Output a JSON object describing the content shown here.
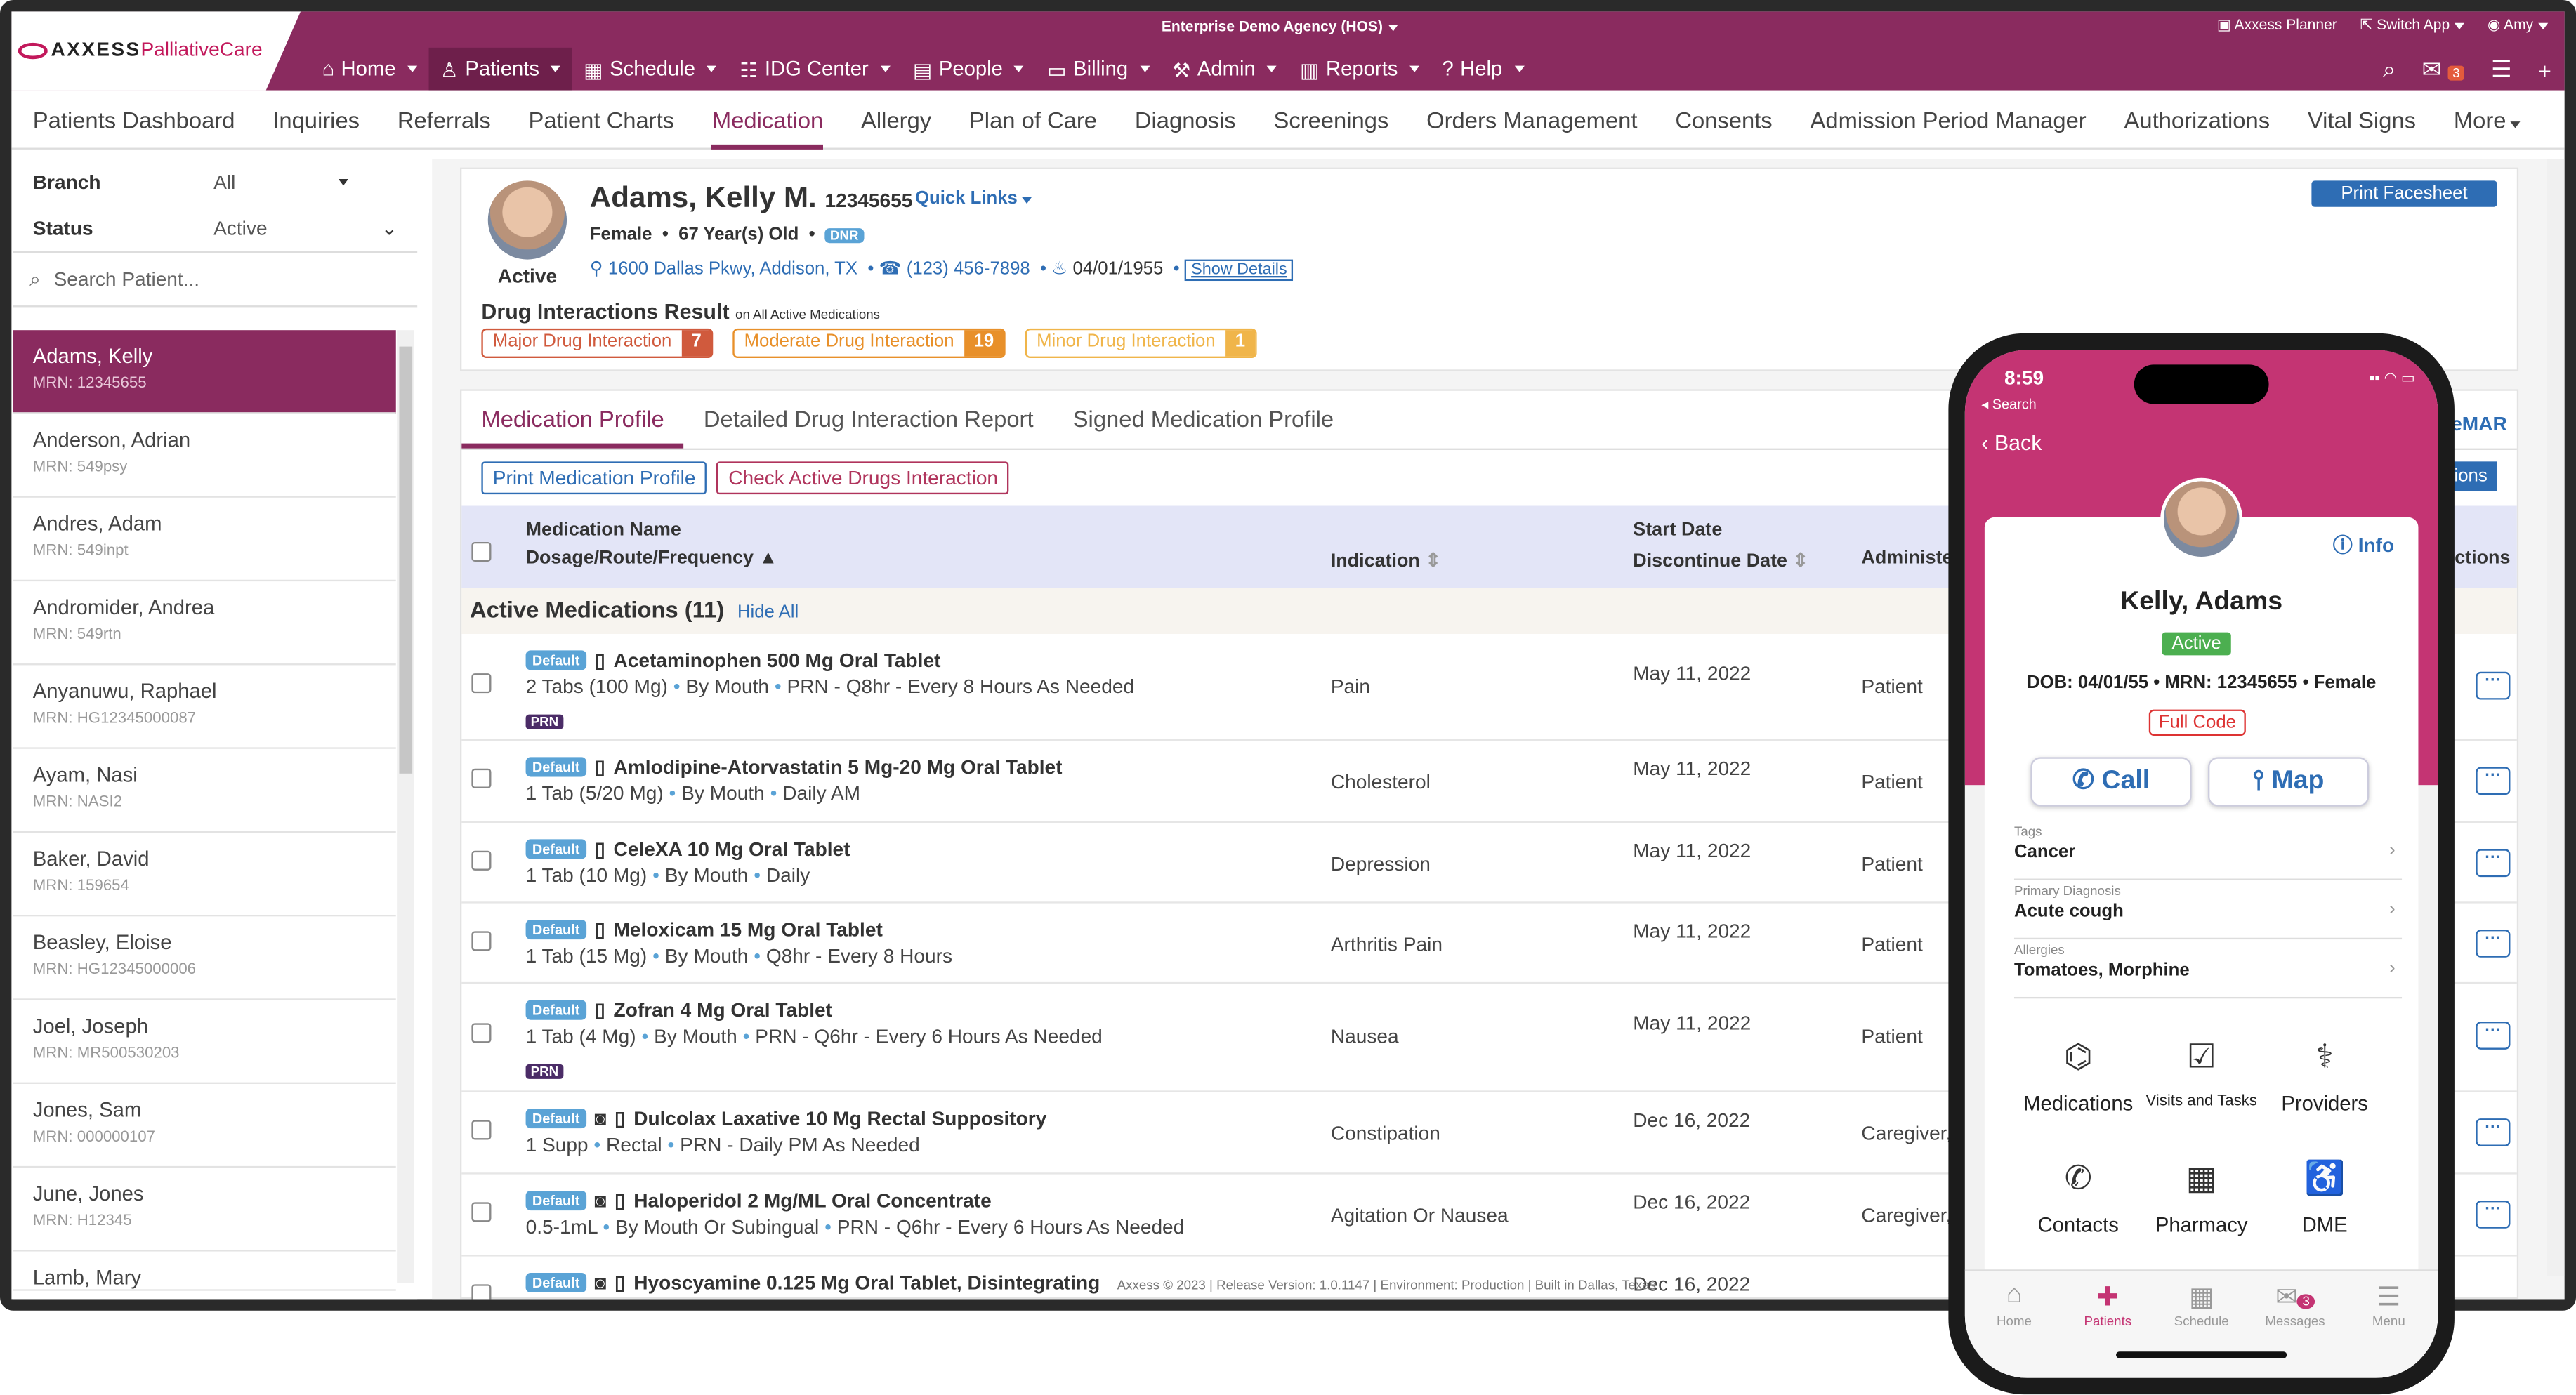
{
  "topbar": {
    "agency": "Enterprise Demo Agency (HOS)",
    "planner": "Axxess Planner",
    "switch_app": "Switch App",
    "user": "Amy",
    "mail_badge": "3"
  },
  "logo": {
    "brand": "AXXESS",
    "product": "PalliativeCare"
  },
  "mainnav": [
    "Home",
    "Patients",
    "Schedule",
    "IDG Center",
    "People",
    "Billing",
    "Admin",
    "Reports",
    "Help"
  ],
  "subnav": [
    "Patients Dashboard",
    "Inquiries",
    "Referrals",
    "Patient Charts",
    "Medication",
    "Allergy",
    "Plan of Care",
    "Diagnosis",
    "Screenings",
    "Orders Management",
    "Consents",
    "Admission Period Manager",
    "Authorizations",
    "Vital Signs",
    "More"
  ],
  "sidebar": {
    "branch_label": "Branch",
    "branch_value": "All",
    "status_label": "Status",
    "status_value": "Active",
    "search_placeholder": "Search Patient...",
    "patients": [
      {
        "name": "Adams, Kelly",
        "mrn": "MRN: 12345655"
      },
      {
        "name": "Anderson, Adrian",
        "mrn": "MRN: 549psy"
      },
      {
        "name": "Andres, Adam",
        "mrn": "MRN: 549inpt"
      },
      {
        "name": "Andromider, Andrea",
        "mrn": "MRN: 549rtn"
      },
      {
        "name": "Anyanuwu, Raphael",
        "mrn": "MRN: HG12345000087"
      },
      {
        "name": "Ayam, Nasi",
        "mrn": "MRN: NASI2"
      },
      {
        "name": "Baker, David",
        "mrn": "MRN: 159654"
      },
      {
        "name": "Beasley, Eloise",
        "mrn": "MRN: HG12345000006"
      },
      {
        "name": "Joel, Joseph",
        "mrn": "MRN: MR500530203"
      },
      {
        "name": "Jones, Sam",
        "mrn": "MRN: 000000107"
      },
      {
        "name": "June, Jones",
        "mrn": "MRN: H12345"
      },
      {
        "name": "Lamb, Mary",
        "mrn": ""
      }
    ]
  },
  "patient": {
    "status": "Active",
    "name": "Adams, Kelly M.",
    "mrn": "12345655",
    "quick_links": "Quick Links",
    "gender": "Female",
    "age": "67 Year(s) Old",
    "dnr": "DNR",
    "address": "1600 Dallas Pkwy, Addison, TX",
    "phone": "(123) 456-7898",
    "dob": "04/01/1955",
    "show_details": "Show Details",
    "print_facesheet": "Print Facesheet"
  },
  "drug_interactions": {
    "title": "Drug Interactions Result",
    "subtitle": "on All Active Medications",
    "major_label": "Major Drug Interaction",
    "major_count": "7",
    "moderate_label": "Moderate Drug Interaction",
    "moderate_count": "19",
    "minor_label": "Minor Drug Interaction",
    "minor_count": "1"
  },
  "med": {
    "tabs": [
      "Medication Profile",
      "Detailed Drug Interaction Report",
      "Signed Medication Profile"
    ],
    "emar": "eMAR",
    "print_btn": "Print Medication Profile",
    "check_btn": "Check Active Drugs Interaction",
    "actions_btn": "Actions",
    "headers": {
      "name1": "Medication Name",
      "name2": "Dosage/Route/Frequency",
      "indication": "Indication",
      "start": "Start Date",
      "discontinue": "Discontinue Date",
      "administered": "Administe",
      "actions": "Actions"
    },
    "section": "Active Medications (11)",
    "hide_all": "Hide All",
    "default_label": "Default",
    "prn_label": "PRN",
    "rows": [
      {
        "name": "Acetaminophen 500 Mg Oral Tablet",
        "dose": "2 Tabs (100 Mg)",
        "route": "By Mouth",
        "freq": "PRN - Q8hr - Every 8 Hours As Needed",
        "ind": "Pain",
        "start": "May 11, 2022",
        "adm": "Patient"
      },
      {
        "name": "Amlodipine-Atorvastatin 5 Mg-20 Mg Oral Tablet",
        "dose": "1 Tab (5/20 Mg)",
        "route": "By Mouth",
        "freq": "Daily AM",
        "ind": "Cholesterol",
        "start": "May 11, 2022",
        "adm": "Patient"
      },
      {
        "name": "CeleXA 10 Mg Oral Tablet",
        "dose": "1 Tab (10 Mg)",
        "route": "By Mouth",
        "freq": "Daily",
        "ind": "Depression",
        "start": "May 11, 2022",
        "adm": "Patient"
      },
      {
        "name": "Meloxicam 15 Mg Oral Tablet",
        "dose": "1 Tab (15 Mg)",
        "route": "By Mouth",
        "freq": "Q8hr - Every 8 Hours",
        "ind": "Arthritis Pain",
        "start": "May 11, 2022",
        "adm": "Patient"
      },
      {
        "name": "Zofran 4 Mg Oral Tablet",
        "dose": "1 Tab (4 Mg)",
        "route": "By Mouth",
        "freq": "PRN - Q6hr - Every 6 Hours As Needed",
        "ind": "Nausea",
        "start": "May 11, 2022",
        "adm": "Patient"
      },
      {
        "name": "Dulcolax Laxative 10 Mg Rectal Suppository",
        "dose": "1 Supp",
        "route": "Rectal",
        "freq": "PRN - Daily PM As Needed",
        "ind": "Constipation",
        "start": "Dec 16, 2022",
        "adm": "Caregiver,"
      },
      {
        "name": "Haloperidol 2 Mg/ML Oral Concentrate",
        "dose": "0.5-1mL",
        "route": "By Mouth Or Subingual",
        "freq": "PRN - Q6hr - Every 6 Hours As Needed",
        "ind": "Agitation Or Nausea",
        "start": "Dec 16, 2022",
        "adm": "Caregiver,"
      },
      {
        "name": "Hyoscyamine 0.125 Mg Oral Tablet, Disintegrating",
        "dose": "",
        "route": "",
        "freq": "",
        "ind": "",
        "start": "Dec 16, 2022",
        "adm": ""
      }
    ]
  },
  "footer": "Axxess © 2023 | Release Version: 1.0.1147 | Environment: Production | Built in Dallas, Texas",
  "phone": {
    "time": "8:59",
    "search": "◂ Search",
    "back": "Back",
    "info": "Info",
    "name": "Kelly, Adams",
    "status": "Active",
    "dob_label": "DOB:",
    "dob": "04/01/55",
    "mrn_label": "MRN:",
    "mrn": "12345655",
    "gender": "Female",
    "code": "Full Code",
    "call": "Call",
    "map": "Map",
    "tags_label": "Tags",
    "tags": "Cancer",
    "dx_label": "Primary Diagnosis",
    "dx": "Acute cough",
    "allergy_label": "Allergies",
    "allergies": "Tomatoes, Morphine",
    "tiles": [
      "Medications",
      "Visits and Tasks",
      "Providers",
      "Contacts",
      "Pharmacy",
      "DME"
    ],
    "tabbar": [
      "Home",
      "Patients",
      "Schedule",
      "Messages",
      "Menu"
    ],
    "msg_badge": "3"
  }
}
